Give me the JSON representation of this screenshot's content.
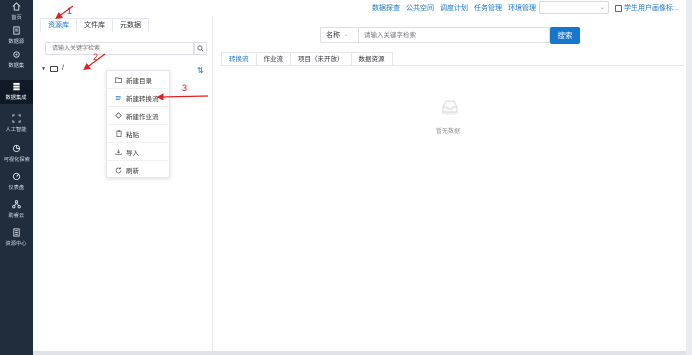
{
  "nav": {
    "items": [
      {
        "label": "首页",
        "icon": "home-icon"
      },
      {
        "label": "数据源",
        "icon": "database-icon"
      },
      {
        "label": "数据集",
        "icon": "dataset-icon"
      },
      {
        "label": "数据集成",
        "icon": "integration-icon"
      },
      {
        "label": "人工智能",
        "icon": "ai-icon"
      },
      {
        "label": "可视化探索",
        "icon": "chart-icon"
      },
      {
        "label": "仪表盘",
        "icon": "dashboard-icon"
      },
      {
        "label": "助睿云",
        "icon": "cloud-icon"
      },
      {
        "label": "资源中心",
        "icon": "resource-icon"
      }
    ],
    "active_index": 3
  },
  "topbar": {
    "links": [
      "数据探查",
      "公共空间",
      "调度计划",
      "任务管理",
      "环境管理"
    ],
    "user": "学生用户画像标..."
  },
  "left_panel": {
    "tabs": [
      "资源库",
      "文件库",
      "元数据"
    ],
    "search_placeholder": "请输入关键字检索",
    "tree_root": "/"
  },
  "context_menu": {
    "items": [
      {
        "label": "新建目录",
        "icon": "folder-icon"
      },
      {
        "label": "新建转换流",
        "icon": "transform-icon"
      },
      {
        "label": "新建作业流",
        "icon": "diamond-icon"
      },
      {
        "label": "粘贴",
        "icon": "paste-icon"
      },
      {
        "label": "导入",
        "icon": "import-icon"
      },
      {
        "label": "刷新",
        "icon": "refresh-icon"
      }
    ]
  },
  "annotations": [
    "1",
    "2",
    "3"
  ],
  "right_panel": {
    "select_value": "名称",
    "search_placeholder": "请输入关键字检索",
    "search_button": "搜索",
    "tabs": [
      "转换流",
      "作业流",
      "项目（未开放）",
      "数据资源"
    ],
    "empty_text": "暂无数据"
  },
  "colors": {
    "accent": "#1677cc",
    "nav_bg": "#1f2d3d",
    "annotation": "#e02020"
  }
}
